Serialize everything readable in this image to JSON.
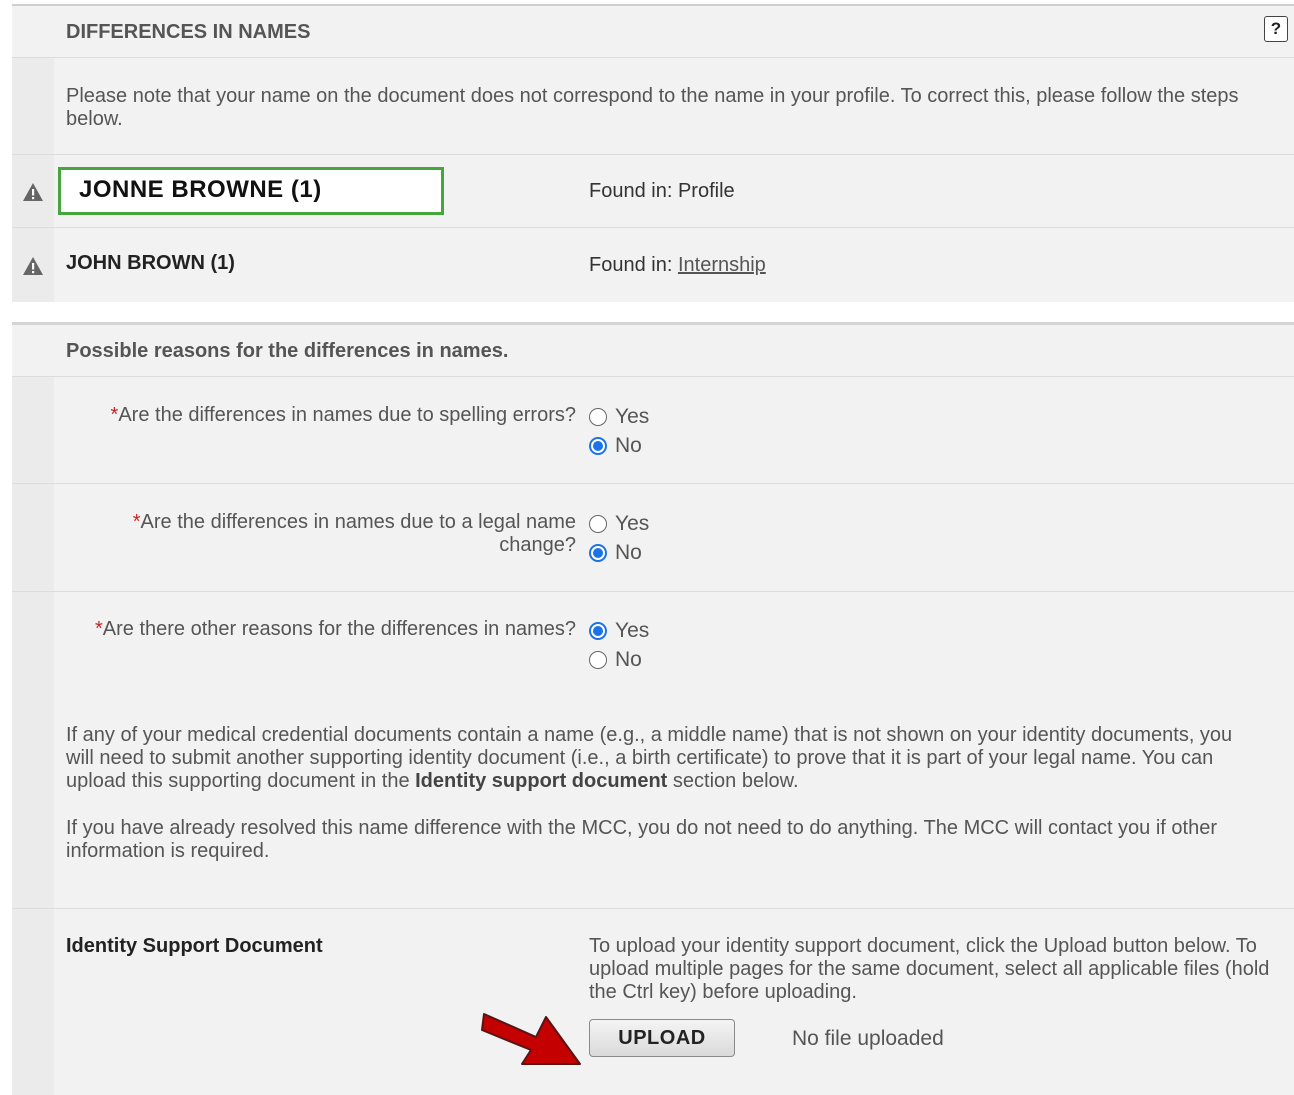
{
  "names_panel": {
    "title": "DIFFERENCES IN NAMES",
    "help_icon": "?",
    "note": "Please note that your name on the document does not correspond to the name in your profile.  To correct this, please follow the steps below.",
    "rows": [
      {
        "name": "JONNE BROWNE (1)",
        "found_label": "Found in: ",
        "found_value": "Profile"
      },
      {
        "name": "JOHN BROWN (1)",
        "found_label": "Found in: ",
        "found_value": "Internship"
      }
    ]
  },
  "reasons_panel": {
    "title": "Possible reasons for the differences in names.",
    "required_mark": "*",
    "questions": [
      {
        "label": "Are the differences in names due to spelling errors?",
        "yes": "Yes",
        "no": "No",
        "selected": "No"
      },
      {
        "label": "Are the differences in names due to a legal name change?",
        "yes": "Yes",
        "no": "No",
        "selected": "No"
      },
      {
        "label": "Are there other reasons for the differences in names?",
        "yes": "Yes",
        "no": "No",
        "selected": "Yes"
      }
    ],
    "info1_before": "If any of your medical credential documents contain a name (e.g., a middle name) that is not shown on your identity documents, you will need to submit another supporting identity document (i.e., a birth certificate) to prove that it is part of your legal name. You can upload this supporting document in the ",
    "info1_bold": "Identity support document",
    "info1_after": " section below.",
    "info2": "If you have already resolved this name difference with the MCC, you do not need to do anything. The MCC will contact you if other information is required.",
    "identity_title": "Identity Support Document",
    "identity_desc": "To upload your identity support document, click the Upload button below. To upload multiple pages for the same document, select all applicable files (hold the Ctrl key) before uploading.",
    "upload_label": "UPLOAD",
    "file_status": "No file uploaded"
  },
  "colors": {
    "highlight_box": "#47a63b",
    "arrow": "#c40000",
    "radio_checked": "#1a73e8",
    "required": "#cc2222"
  }
}
